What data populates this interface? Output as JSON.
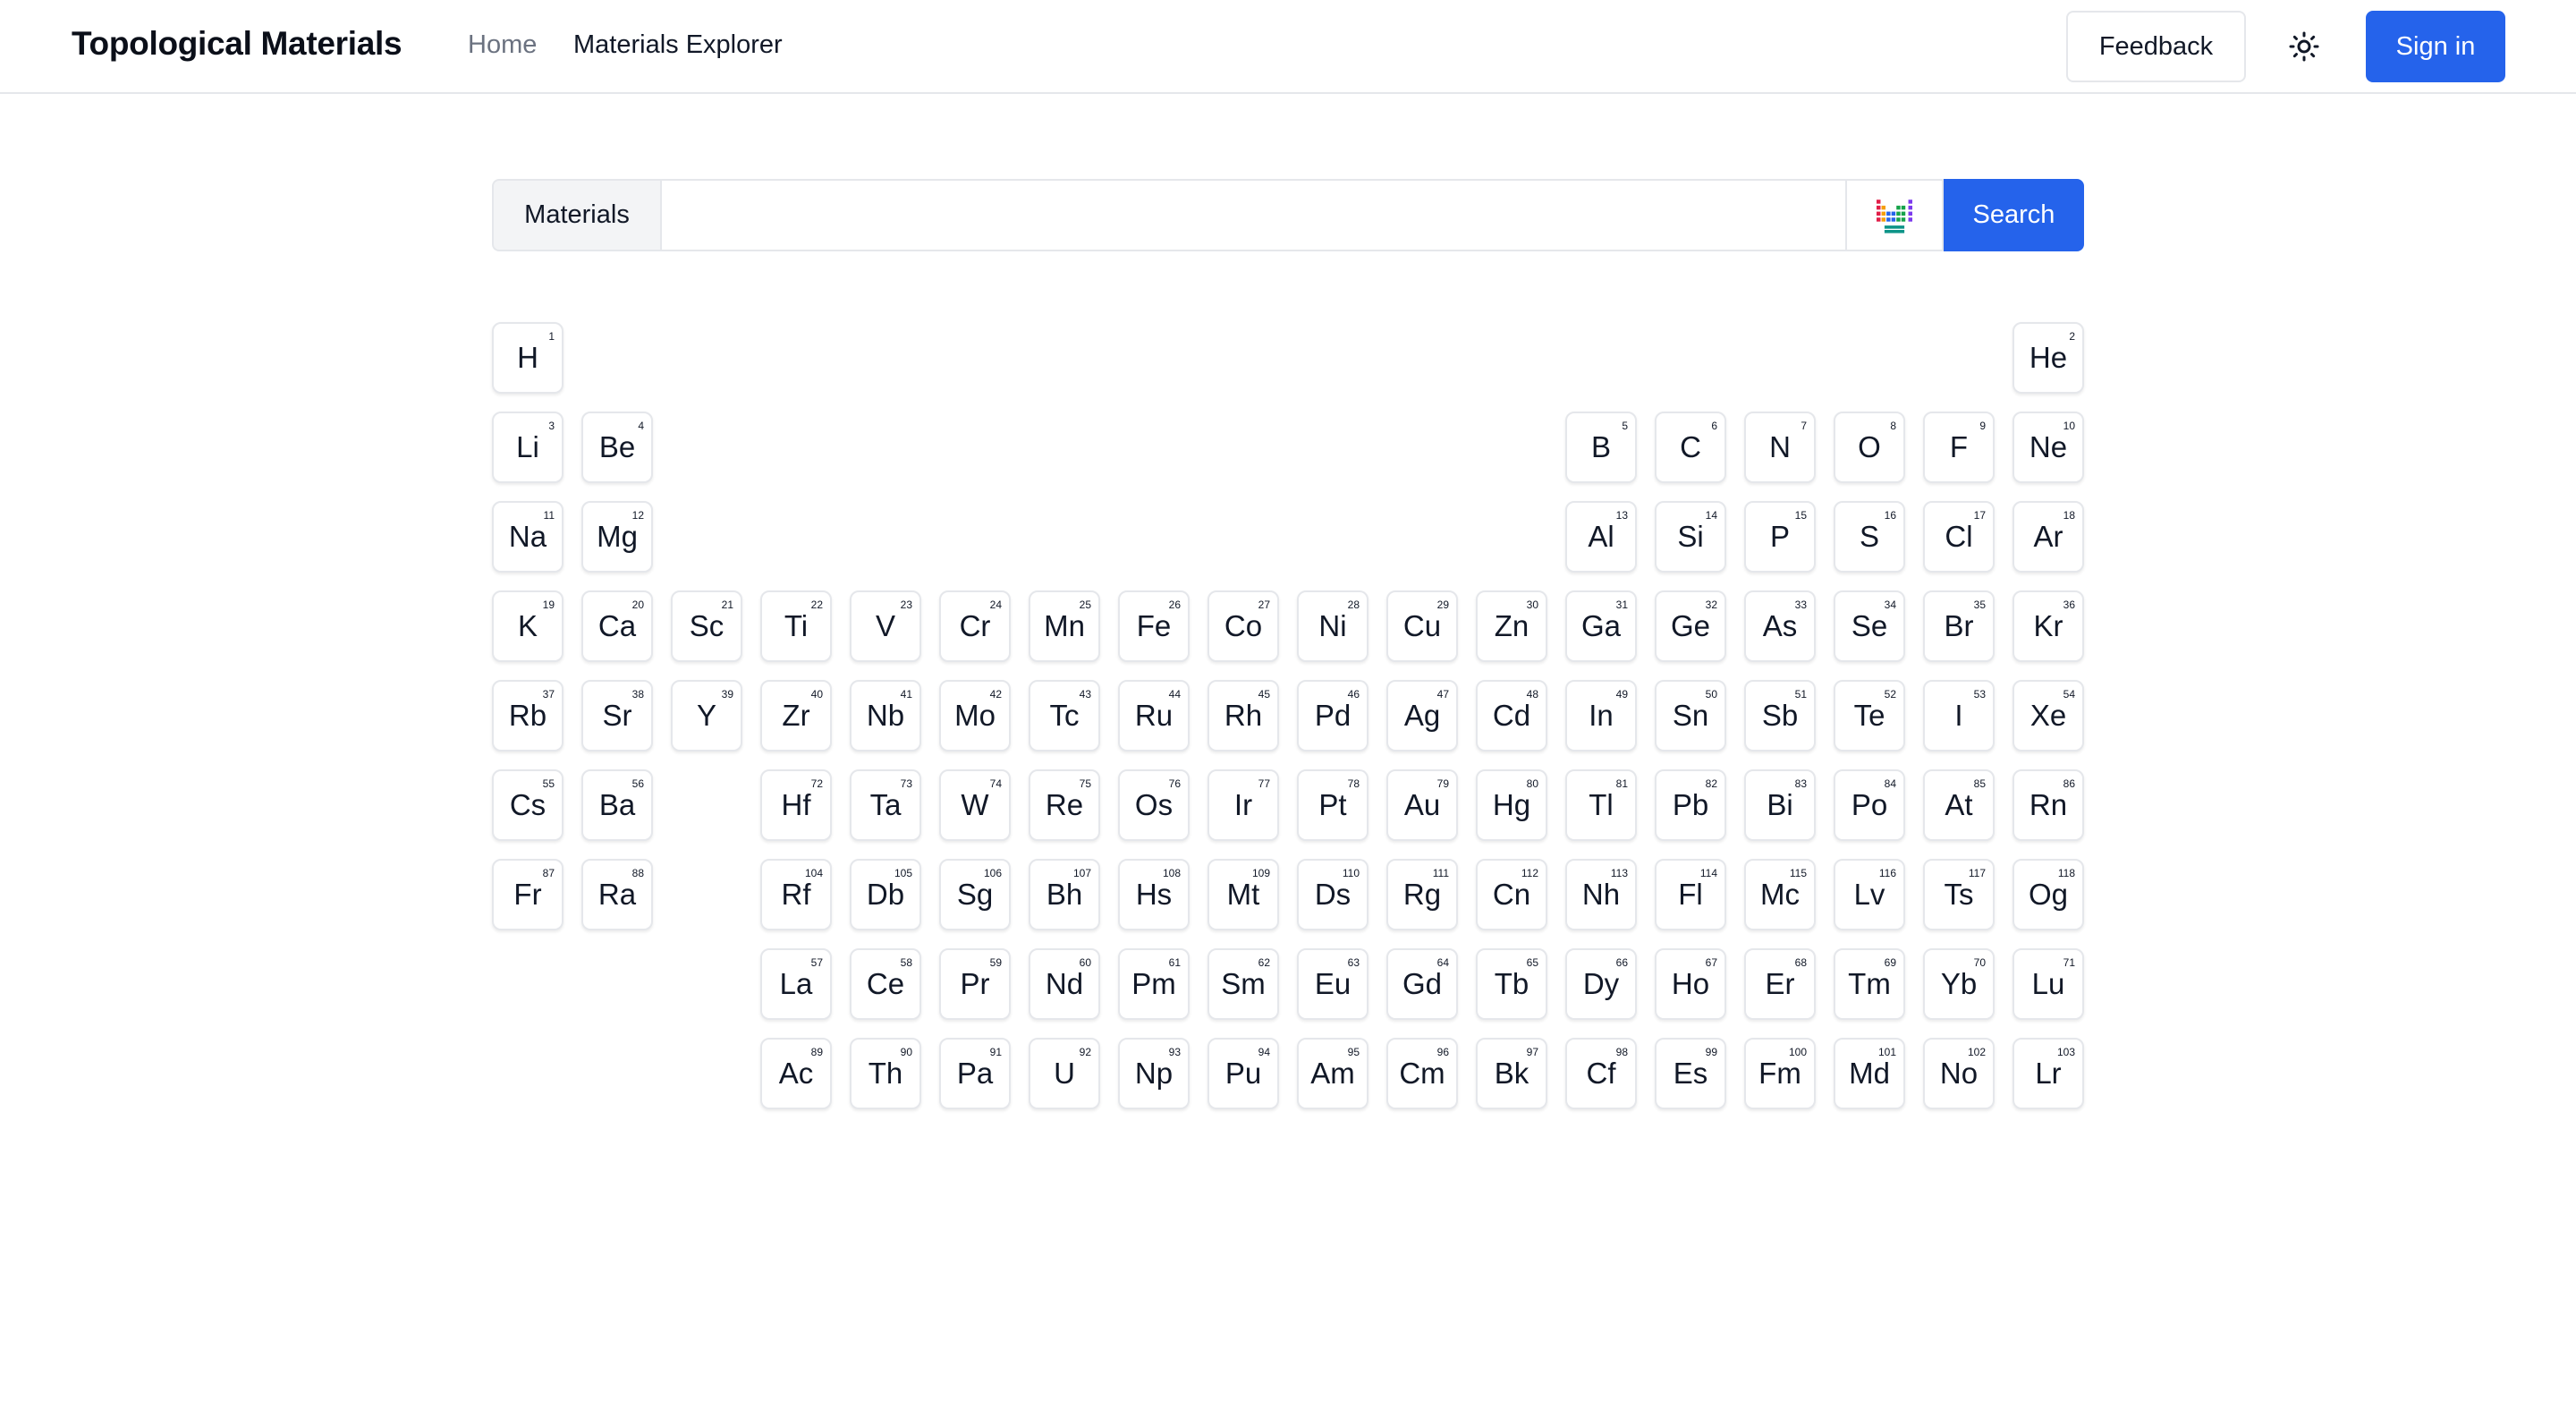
{
  "header": {
    "brand": "Topological Materials",
    "nav": {
      "home": "Home",
      "explorer": "Materials Explorer"
    },
    "feedback_label": "Feedback",
    "theme_icon": "sun-icon",
    "signin_label": "Sign in"
  },
  "search": {
    "label": "Materials",
    "value": "",
    "placeholder": "",
    "periodic_table_icon": "periodic-table-icon",
    "button_label": "Search"
  },
  "colors": {
    "primary": "#2563eb",
    "border": "#e5e7eb",
    "label_bg": "#f3f4f6"
  },
  "elements": [
    {
      "s": "H",
      "n": 1,
      "r": 1,
      "c": 1
    },
    {
      "s": "He",
      "n": 2,
      "r": 1,
      "c": 18
    },
    {
      "s": "Li",
      "n": 3,
      "r": 2,
      "c": 1
    },
    {
      "s": "Be",
      "n": 4,
      "r": 2,
      "c": 2
    },
    {
      "s": "B",
      "n": 5,
      "r": 2,
      "c": 13
    },
    {
      "s": "C",
      "n": 6,
      "r": 2,
      "c": 14
    },
    {
      "s": "N",
      "n": 7,
      "r": 2,
      "c": 15
    },
    {
      "s": "O",
      "n": 8,
      "r": 2,
      "c": 16
    },
    {
      "s": "F",
      "n": 9,
      "r": 2,
      "c": 17
    },
    {
      "s": "Ne",
      "n": 10,
      "r": 2,
      "c": 18
    },
    {
      "s": "Na",
      "n": 11,
      "r": 3,
      "c": 1
    },
    {
      "s": "Mg",
      "n": 12,
      "r": 3,
      "c": 2
    },
    {
      "s": "Al",
      "n": 13,
      "r": 3,
      "c": 13
    },
    {
      "s": "Si",
      "n": 14,
      "r": 3,
      "c": 14
    },
    {
      "s": "P",
      "n": 15,
      "r": 3,
      "c": 15
    },
    {
      "s": "S",
      "n": 16,
      "r": 3,
      "c": 16
    },
    {
      "s": "Cl",
      "n": 17,
      "r": 3,
      "c": 17
    },
    {
      "s": "Ar",
      "n": 18,
      "r": 3,
      "c": 18
    },
    {
      "s": "K",
      "n": 19,
      "r": 4,
      "c": 1
    },
    {
      "s": "Ca",
      "n": 20,
      "r": 4,
      "c": 2
    },
    {
      "s": "Sc",
      "n": 21,
      "r": 4,
      "c": 3
    },
    {
      "s": "Ti",
      "n": 22,
      "r": 4,
      "c": 4
    },
    {
      "s": "V",
      "n": 23,
      "r": 4,
      "c": 5
    },
    {
      "s": "Cr",
      "n": 24,
      "r": 4,
      "c": 6
    },
    {
      "s": "Mn",
      "n": 25,
      "r": 4,
      "c": 7
    },
    {
      "s": "Fe",
      "n": 26,
      "r": 4,
      "c": 8
    },
    {
      "s": "Co",
      "n": 27,
      "r": 4,
      "c": 9
    },
    {
      "s": "Ni",
      "n": 28,
      "r": 4,
      "c": 10
    },
    {
      "s": "Cu",
      "n": 29,
      "r": 4,
      "c": 11
    },
    {
      "s": "Zn",
      "n": 30,
      "r": 4,
      "c": 12
    },
    {
      "s": "Ga",
      "n": 31,
      "r": 4,
      "c": 13
    },
    {
      "s": "Ge",
      "n": 32,
      "r": 4,
      "c": 14
    },
    {
      "s": "As",
      "n": 33,
      "r": 4,
      "c": 15
    },
    {
      "s": "Se",
      "n": 34,
      "r": 4,
      "c": 16
    },
    {
      "s": "Br",
      "n": 35,
      "r": 4,
      "c": 17
    },
    {
      "s": "Kr",
      "n": 36,
      "r": 4,
      "c": 18
    },
    {
      "s": "Rb",
      "n": 37,
      "r": 5,
      "c": 1
    },
    {
      "s": "Sr",
      "n": 38,
      "r": 5,
      "c": 2
    },
    {
      "s": "Y",
      "n": 39,
      "r": 5,
      "c": 3
    },
    {
      "s": "Zr",
      "n": 40,
      "r": 5,
      "c": 4
    },
    {
      "s": "Nb",
      "n": 41,
      "r": 5,
      "c": 5
    },
    {
      "s": "Mo",
      "n": 42,
      "r": 5,
      "c": 6
    },
    {
      "s": "Tc",
      "n": 43,
      "r": 5,
      "c": 7
    },
    {
      "s": "Ru",
      "n": 44,
      "r": 5,
      "c": 8
    },
    {
      "s": "Rh",
      "n": 45,
      "r": 5,
      "c": 9
    },
    {
      "s": "Pd",
      "n": 46,
      "r": 5,
      "c": 10
    },
    {
      "s": "Ag",
      "n": 47,
      "r": 5,
      "c": 11
    },
    {
      "s": "Cd",
      "n": 48,
      "r": 5,
      "c": 12
    },
    {
      "s": "In",
      "n": 49,
      "r": 5,
      "c": 13
    },
    {
      "s": "Sn",
      "n": 50,
      "r": 5,
      "c": 14
    },
    {
      "s": "Sb",
      "n": 51,
      "r": 5,
      "c": 15
    },
    {
      "s": "Te",
      "n": 52,
      "r": 5,
      "c": 16
    },
    {
      "s": "I",
      "n": 53,
      "r": 5,
      "c": 17
    },
    {
      "s": "Xe",
      "n": 54,
      "r": 5,
      "c": 18
    },
    {
      "s": "Cs",
      "n": 55,
      "r": 6,
      "c": 1
    },
    {
      "s": "Ba",
      "n": 56,
      "r": 6,
      "c": 2
    },
    {
      "s": "Hf",
      "n": 72,
      "r": 6,
      "c": 4
    },
    {
      "s": "Ta",
      "n": 73,
      "r": 6,
      "c": 5
    },
    {
      "s": "W",
      "n": 74,
      "r": 6,
      "c": 6
    },
    {
      "s": "Re",
      "n": 75,
      "r": 6,
      "c": 7
    },
    {
      "s": "Os",
      "n": 76,
      "r": 6,
      "c": 8
    },
    {
      "s": "Ir",
      "n": 77,
      "r": 6,
      "c": 9
    },
    {
      "s": "Pt",
      "n": 78,
      "r": 6,
      "c": 10
    },
    {
      "s": "Au",
      "n": 79,
      "r": 6,
      "c": 11
    },
    {
      "s": "Hg",
      "n": 80,
      "r": 6,
      "c": 12
    },
    {
      "s": "Tl",
      "n": 81,
      "r": 6,
      "c": 13
    },
    {
      "s": "Pb",
      "n": 82,
      "r": 6,
      "c": 14
    },
    {
      "s": "Bi",
      "n": 83,
      "r": 6,
      "c": 15
    },
    {
      "s": "Po",
      "n": 84,
      "r": 6,
      "c": 16
    },
    {
      "s": "At",
      "n": 85,
      "r": 6,
      "c": 17
    },
    {
      "s": "Rn",
      "n": 86,
      "r": 6,
      "c": 18
    },
    {
      "s": "Fr",
      "n": 87,
      "r": 7,
      "c": 1
    },
    {
      "s": "Ra",
      "n": 88,
      "r": 7,
      "c": 2
    },
    {
      "s": "Rf",
      "n": 104,
      "r": 7,
      "c": 4
    },
    {
      "s": "Db",
      "n": 105,
      "r": 7,
      "c": 5
    },
    {
      "s": "Sg",
      "n": 106,
      "r": 7,
      "c": 6
    },
    {
      "s": "Bh",
      "n": 107,
      "r": 7,
      "c": 7
    },
    {
      "s": "Hs",
      "n": 108,
      "r": 7,
      "c": 8
    },
    {
      "s": "Mt",
      "n": 109,
      "r": 7,
      "c": 9
    },
    {
      "s": "Ds",
      "n": 110,
      "r": 7,
      "c": 10
    },
    {
      "s": "Rg",
      "n": 111,
      "r": 7,
      "c": 11
    },
    {
      "s": "Cn",
      "n": 112,
      "r": 7,
      "c": 12
    },
    {
      "s": "Nh",
      "n": 113,
      "r": 7,
      "c": 13
    },
    {
      "s": "Fl",
      "n": 114,
      "r": 7,
      "c": 14
    },
    {
      "s": "Mc",
      "n": 115,
      "r": 7,
      "c": 15
    },
    {
      "s": "Lv",
      "n": 116,
      "r": 7,
      "c": 16
    },
    {
      "s": "Ts",
      "n": 117,
      "r": 7,
      "c": 17
    },
    {
      "s": "Og",
      "n": 118,
      "r": 7,
      "c": 18
    },
    {
      "s": "La",
      "n": 57,
      "r": 8,
      "c": 4
    },
    {
      "s": "Ce",
      "n": 58,
      "r": 8,
      "c": 5
    },
    {
      "s": "Pr",
      "n": 59,
      "r": 8,
      "c": 6
    },
    {
      "s": "Nd",
      "n": 60,
      "r": 8,
      "c": 7
    },
    {
      "s": "Pm",
      "n": 61,
      "r": 8,
      "c": 8
    },
    {
      "s": "Sm",
      "n": 62,
      "r": 8,
      "c": 9
    },
    {
      "s": "Eu",
      "n": 63,
      "r": 8,
      "c": 10
    },
    {
      "s": "Gd",
      "n": 64,
      "r": 8,
      "c": 11
    },
    {
      "s": "Tb",
      "n": 65,
      "r": 8,
      "c": 12
    },
    {
      "s": "Dy",
      "n": 66,
      "r": 8,
      "c": 13
    },
    {
      "s": "Ho",
      "n": 67,
      "r": 8,
      "c": 14
    },
    {
      "s": "Er",
      "n": 68,
      "r": 8,
      "c": 15
    },
    {
      "s": "Tm",
      "n": 69,
      "r": 8,
      "c": 16
    },
    {
      "s": "Yb",
      "n": 70,
      "r": 8,
      "c": 17
    },
    {
      "s": "Lu",
      "n": 71,
      "r": 8,
      "c": 18
    },
    {
      "s": "Ac",
      "n": 89,
      "r": 9,
      "c": 4
    },
    {
      "s": "Th",
      "n": 90,
      "r": 9,
      "c": 5
    },
    {
      "s": "Pa",
      "n": 91,
      "r": 9,
      "c": 6
    },
    {
      "s": "U",
      "n": 92,
      "r": 9,
      "c": 7
    },
    {
      "s": "Np",
      "n": 93,
      "r": 9,
      "c": 8
    },
    {
      "s": "Pu",
      "n": 94,
      "r": 9,
      "c": 9
    },
    {
      "s": "Am",
      "n": 95,
      "r": 9,
      "c": 10
    },
    {
      "s": "Cm",
      "n": 96,
      "r": 9,
      "c": 11
    },
    {
      "s": "Bk",
      "n": 97,
      "r": 9,
      "c": 12
    },
    {
      "s": "Cf",
      "n": 98,
      "r": 9,
      "c": 13
    },
    {
      "s": "Es",
      "n": 99,
      "r": 9,
      "c": 14
    },
    {
      "s": "Fm",
      "n": 100,
      "r": 9,
      "c": 15
    },
    {
      "s": "Md",
      "n": 101,
      "r": 9,
      "c": 16
    },
    {
      "s": "No",
      "n": 102,
      "r": 9,
      "c": 17
    },
    {
      "s": "Lr",
      "n": 103,
      "r": 9,
      "c": 18
    }
  ]
}
